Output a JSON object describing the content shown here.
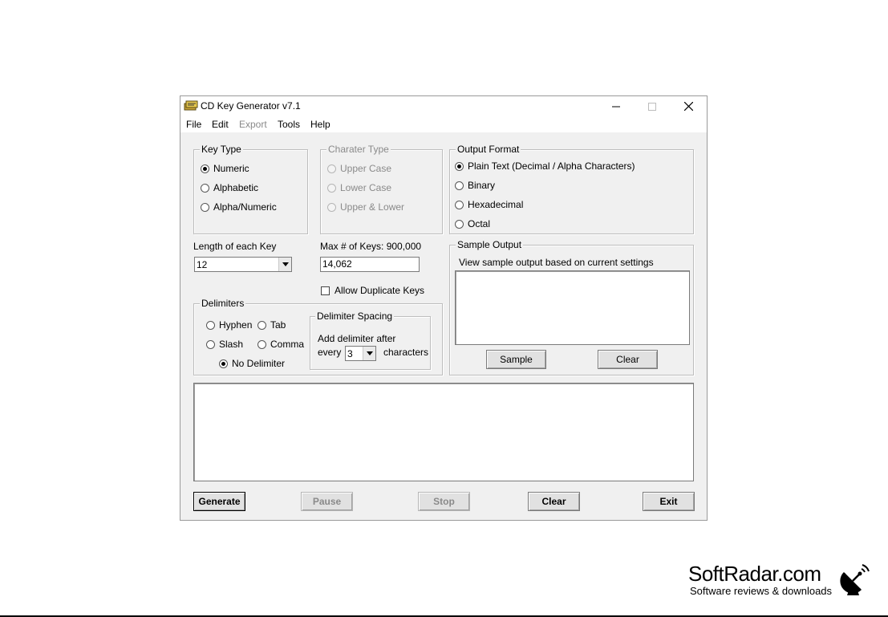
{
  "window": {
    "title": "CD Key Generator v7.1",
    "controls": {
      "minimize": "—",
      "maximize": "☐",
      "close": "✕"
    }
  },
  "menu": {
    "file": "File",
    "edit": "Edit",
    "export": "Export",
    "tools": "Tools",
    "help": "Help"
  },
  "key_type": {
    "legend": "Key Type",
    "options": [
      "Numeric",
      "Alphabetic",
      "Alpha/Numeric"
    ],
    "selected": "Numeric"
  },
  "character_type": {
    "legend": "Charater Type",
    "options": [
      "Upper Case",
      "Lower Case",
      "Upper & Lower"
    ],
    "enabled": false
  },
  "output_format": {
    "legend": "Output Format",
    "options": [
      "Plain Text (Decimal / Alpha Characters)",
      "Binary",
      "Hexadecimal",
      "Octal"
    ],
    "selected": "Plain Text (Decimal / Alpha Characters)"
  },
  "length": {
    "label": "Length of each Key",
    "value": "12"
  },
  "max_keys": {
    "label": "Max # of Keys: 900,000",
    "value": "14,062"
  },
  "allow_duplicates": {
    "label": "Allow Duplicate Keys",
    "checked": false
  },
  "delimiters": {
    "legend": "Delimiters",
    "hyphen": "Hyphen",
    "tab": "Tab",
    "slash": "Slash",
    "comma": "Comma",
    "none": "No Delimiter",
    "selected": "No Delimiter"
  },
  "delimiter_spacing": {
    "legend": "Delimiter Spacing",
    "add_after": "Add delimiter after",
    "every": "every",
    "value": "3",
    "characters": "characters"
  },
  "sample_output": {
    "legend": "Sample Output",
    "description": "View sample output based on current settings",
    "sample_button": "Sample",
    "clear_button": "Clear"
  },
  "actions": {
    "generate": "Generate",
    "pause": "Pause",
    "stop": "Stop",
    "clear": "Clear",
    "exit": "Exit"
  },
  "brand": {
    "name": "SoftRadar.com",
    "tagline": "Software reviews & downloads"
  }
}
